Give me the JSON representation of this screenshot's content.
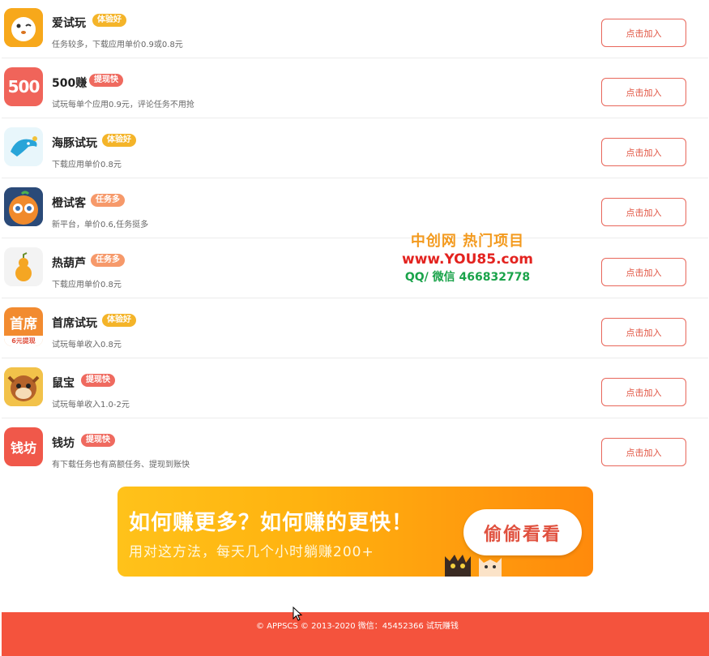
{
  "apps": [
    {
      "name": "爱试玩",
      "badge": "体验好",
      "badge_color": "#f4b429",
      "desc": "任务较多，下载应用单价0.9或0.8元",
      "icon": "lion-icon",
      "icon_bg": "#f7a81b"
    },
    {
      "name": "500赚",
      "badge": "提现快",
      "badge_color": "#ef6a5f",
      "desc": "试玩每单个应用0.9元，评论任务不用抢",
      "icon": "500-icon",
      "icon_bg": "#f0645a"
    },
    {
      "name": "海豚试玩",
      "badge": "体验好",
      "badge_color": "#f4b429",
      "desc": "下载应用单价0.8元",
      "icon": "dolphin-icon",
      "icon_bg": "#e8f6fb"
    },
    {
      "name": "橙试客",
      "badge": "任务多",
      "badge_color": "#f6996a",
      "desc": "新平台，单价0.6,任务挺多",
      "icon": "orange-icon",
      "icon_bg": "#2b4a78"
    },
    {
      "name": "热葫芦",
      "badge": "任务多",
      "badge_color": "#f6996a",
      "desc": "下载应用单价0.8元",
      "icon": "gourd-icon",
      "icon_bg": "#f3f3f3"
    },
    {
      "name": "首席试玩",
      "badge": "体验好",
      "badge_color": "#f4b429",
      "desc": "试玩每单收入0.8元",
      "icon": "shouxi-icon",
      "icon_bg": "#f28b30"
    },
    {
      "name": "鼠宝",
      "badge": "提现快",
      "badge_color": "#ef6a5f",
      "desc": "试玩每单收入1.0-2元",
      "icon": "squirrel-icon",
      "icon_bg": "#f2c24a"
    },
    {
      "name": "钱坊",
      "badge": "提现快",
      "badge_color": "#ef6a5f",
      "desc": "有下载任务也有高额任务、提现到账快",
      "icon": "qianfang-icon",
      "icon_bg": "#f0584a"
    }
  ],
  "join_label": "点击加入",
  "icon_text": {
    "five_hundred": "500",
    "shouxi": "首席",
    "shouxi_sub": "6元提现",
    "qianfang": "钱坊"
  },
  "banner": {
    "title": "如何赚更多？如何赚的更快！",
    "subtitle": "用对这方法，每天几个小时躺赚200+",
    "button": "偷偷看看"
  },
  "watermark": {
    "line1": "中创网 热门项目",
    "line2": "www.YOU85.com",
    "line3": "QQ/ 微信 466832778"
  },
  "footer": {
    "text": "© APPSCS © 2013-2020 微信：45452366  试玩赚钱"
  }
}
